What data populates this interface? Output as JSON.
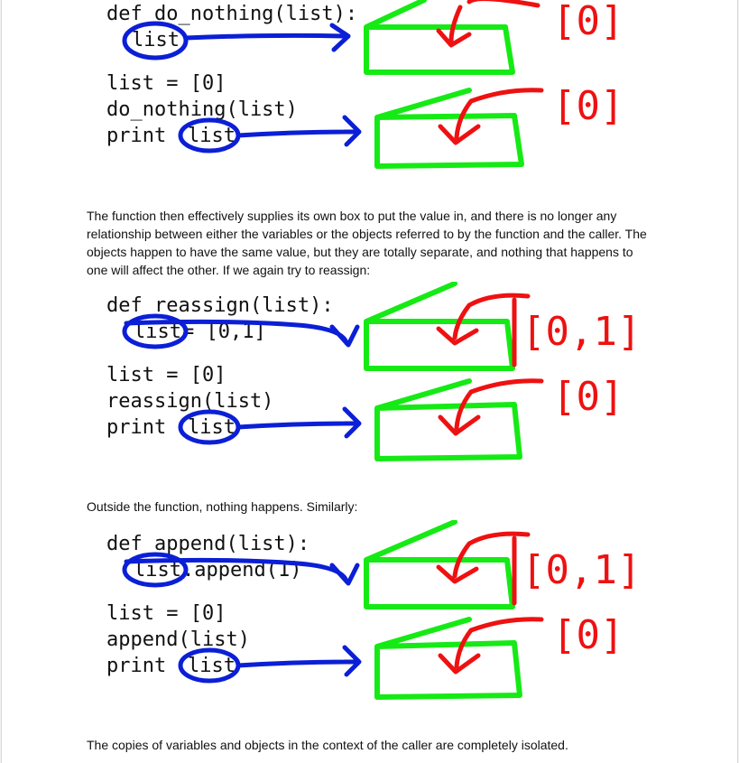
{
  "figure1": {
    "def_line": "def do_nothing(list):",
    "param": "list",
    "assign": "list = [0]",
    "call": "do_nothing(list)",
    "print_kw": "print",
    "print_arg": "list",
    "value_top": "[0]",
    "value_bottom": "[0]"
  },
  "paragraph1": "The function then effectively supplies its own box to put the value in, and there is no longer any relationship between either the variables or the objects referred to by the function and the caller. The objects happen to have the same value, but they are totally separate, and nothing that happens to one will affect the other. If we again try to reassign:",
  "figure2": {
    "def_line": "def reassign(list):",
    "param": "list",
    "param_rest": " = [0,1]",
    "assign": "list = [0]",
    "call": "reassign(list)",
    "print_kw": "print",
    "print_arg": "list",
    "value_top": "[0,1]",
    "value_bottom": "[0]"
  },
  "paragraph2": "Outside the function, nothing happens. Similarly:",
  "figure3": {
    "def_line": "def append(list):",
    "param": "list",
    "param_rest": ".append(1)",
    "assign": "list = [0]",
    "call": "append(list)",
    "print_kw": "print",
    "print_arg": "list",
    "value_top": "[0,1]",
    "value_bottom": "[0]"
  },
  "paragraph3": "The copies of variables and objects in the context of the caller are completely isolated.",
  "colors": {
    "variable_ink": "#0b1fd6",
    "box_ink": "#15ea15",
    "value_ink": "#ee1111"
  }
}
